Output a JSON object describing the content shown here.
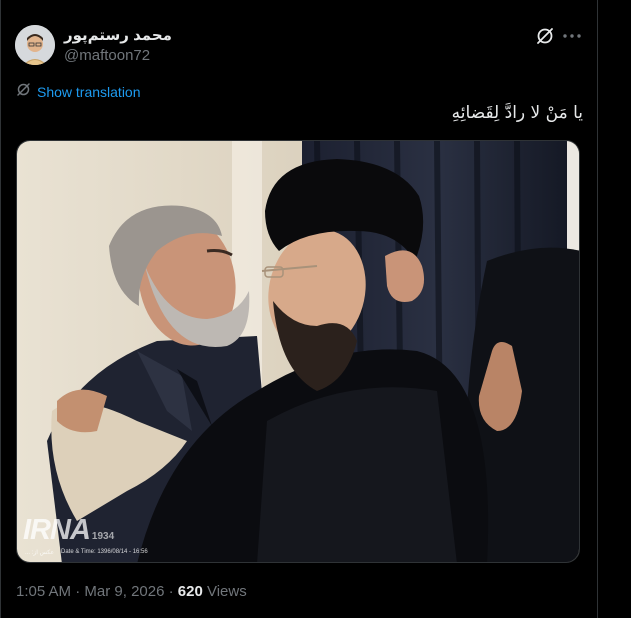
{
  "author": {
    "display_name": "محمد رستم‌پور",
    "handle": "@maftoon72"
  },
  "actions": {
    "grok_icon": "grok-icon",
    "more_icon": "more-icon"
  },
  "translation": {
    "label": "Show translation",
    "icon": "translate-icon"
  },
  "tweet": {
    "text": "یا مَنْ لا رادَّ لِقَضائِهِ"
  },
  "photo": {
    "watermark_logo": "IRNA",
    "watermark_year": "1934",
    "watermark_credit": "عکس از: ...",
    "watermark_date": "Date & Time: 1396/08/14 - 16:56"
  },
  "meta": {
    "time": "1:05 AM",
    "separator": "·",
    "date": "Mar 9, 2026",
    "views_count": "620",
    "views_label": "Views"
  },
  "colors": {
    "background": "#000000",
    "text_primary": "#e7e9ea",
    "text_secondary": "#71767b",
    "link": "#1d9bf0",
    "border": "#2f3336"
  }
}
